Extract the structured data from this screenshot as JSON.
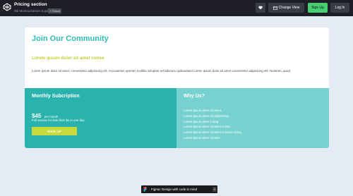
{
  "topbar": {
    "title": "Pricing section",
    "author": "Md Moniruzzaman Sojol",
    "follow_label": "+ Follow",
    "heart_icon": "heart-icon",
    "change_view_label": "Change View",
    "signup_label": "Sign Up",
    "login_label": "Log In"
  },
  "card": {
    "heading": "Join Our Community",
    "subheading": "Lorem ipsum dolor sit amet conse",
    "body": "Lorem ipsum dolor sit amet, consectetur adipisicing elit. Accusamus operam mollitia voluptas vel laborum quibusdam! Lorem ipsum dolor sit amet consectetur adipisicing elit. Nostrum, quod.",
    "monthly": {
      "title": "Monthly Subcription",
      "price": "$45",
      "unit": "per month",
      "access": "Full access for less than $1 in one day",
      "cta": "SIGN UP"
    },
    "why": {
      "title": "Why Us?",
      "items": [
        "Lorem ipsum dolor sit amet.",
        "Lorem ipsum dolor sit adipisicing.",
        "Lorem ipsum dolor s long.",
        "Lorem ipsum dolor sit amet conse.",
        "Lorem ipsum dolor sit amet consect sicing.",
        "Lorem ipsum dolor sit ame"
      ]
    }
  },
  "figma": {
    "label": "Figma: Design with code in mind",
    "close": "×"
  },
  "colors": {
    "topbar": "#1e1f26",
    "teal": "#2ab2ac",
    "light_teal": "#78d1d1",
    "lime": "#c8d93b",
    "heading": "#2ebbb4",
    "green": "#47cf73"
  }
}
